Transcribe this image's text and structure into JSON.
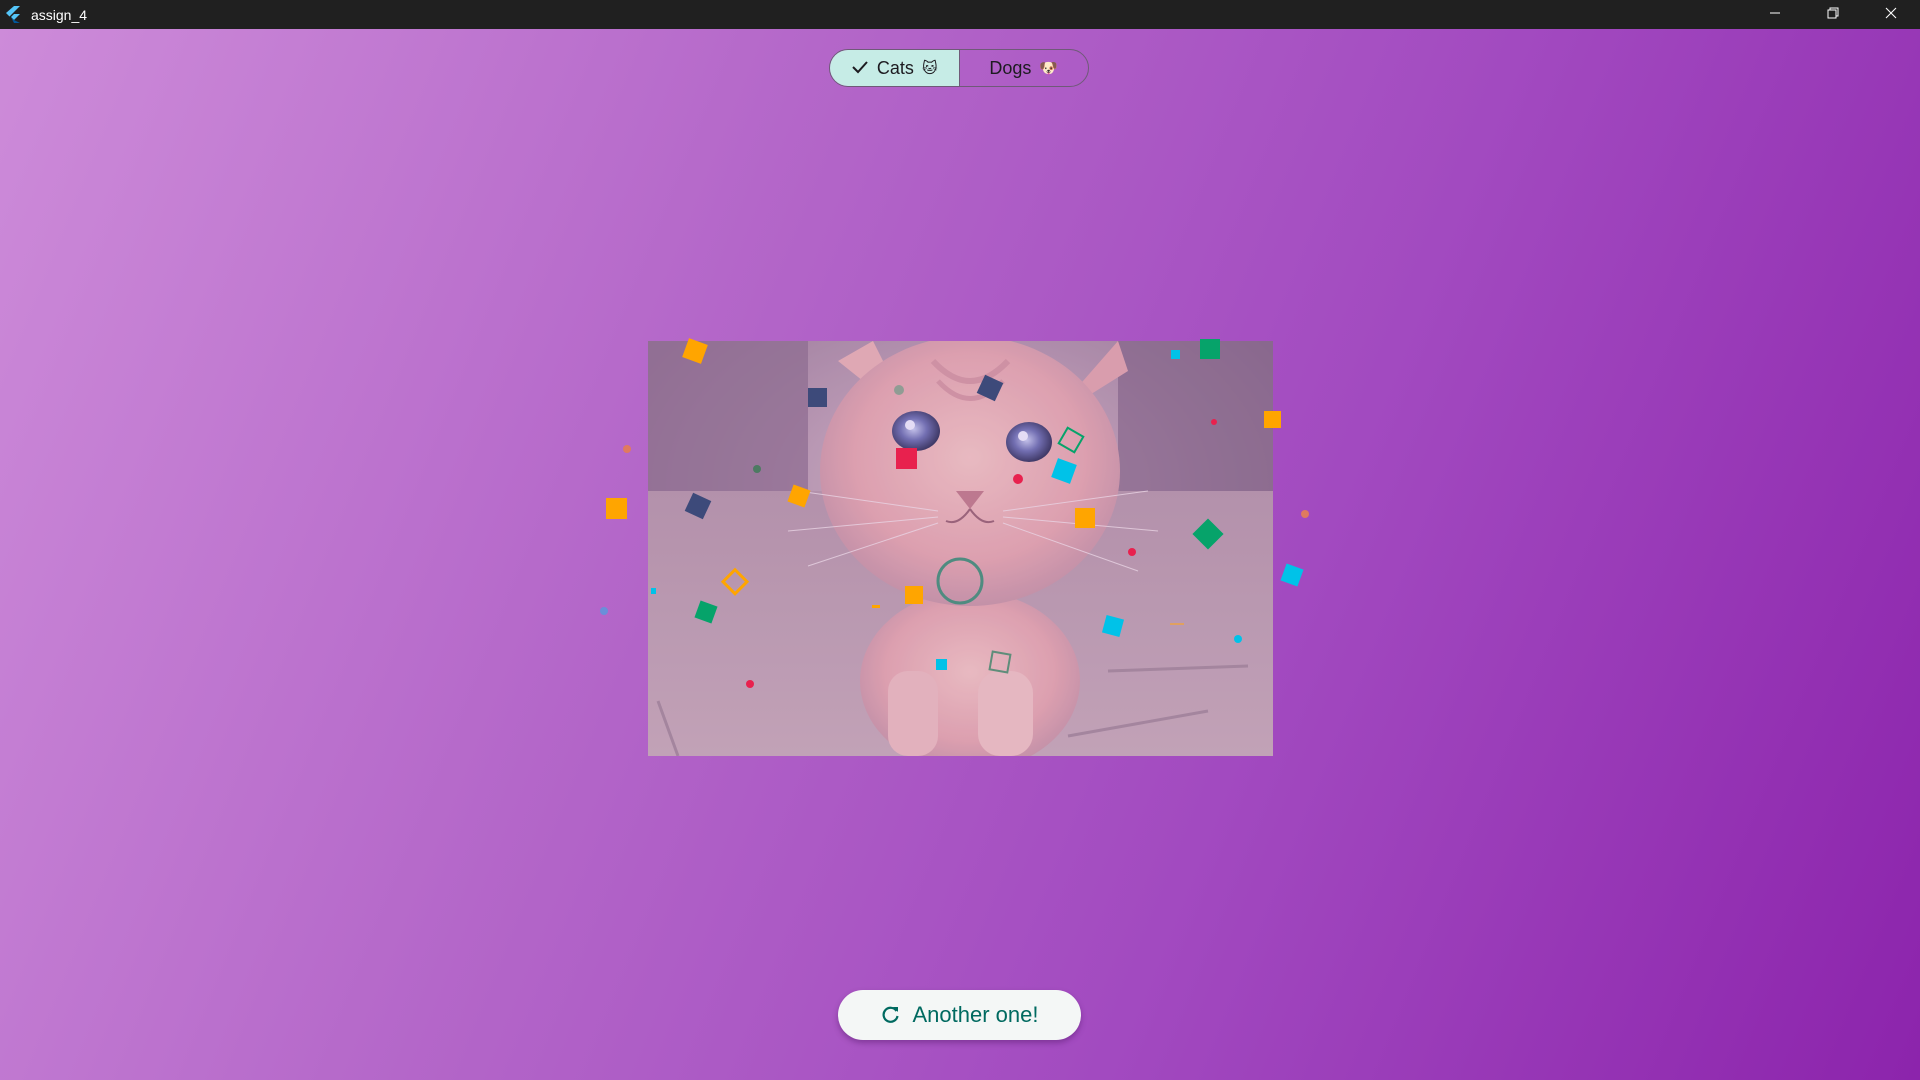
{
  "window": {
    "title": "assign_4",
    "controls": [
      "minimize-icon",
      "restore-icon",
      "close-icon"
    ]
  },
  "toggle": {
    "options": [
      {
        "label": "Cats",
        "emoji": "🐱",
        "selected": true,
        "icon": "check-icon"
      },
      {
        "label": "Dogs",
        "emoji": "🐶",
        "selected": false
      }
    ]
  },
  "image": {
    "subject": "kitten photo with purple overlay"
  },
  "action": {
    "label": "Another one!",
    "icon": "refresh-icon"
  },
  "colors": {
    "gradient_start": "#cd8bd9",
    "gradient_end": "#8c24ac",
    "selected_segment": "#c6ece6",
    "button_text": "#006a60",
    "confetti": [
      "#ffa500",
      "#00c2e8",
      "#e8214e",
      "#06a36a",
      "#3d4a7a"
    ]
  }
}
